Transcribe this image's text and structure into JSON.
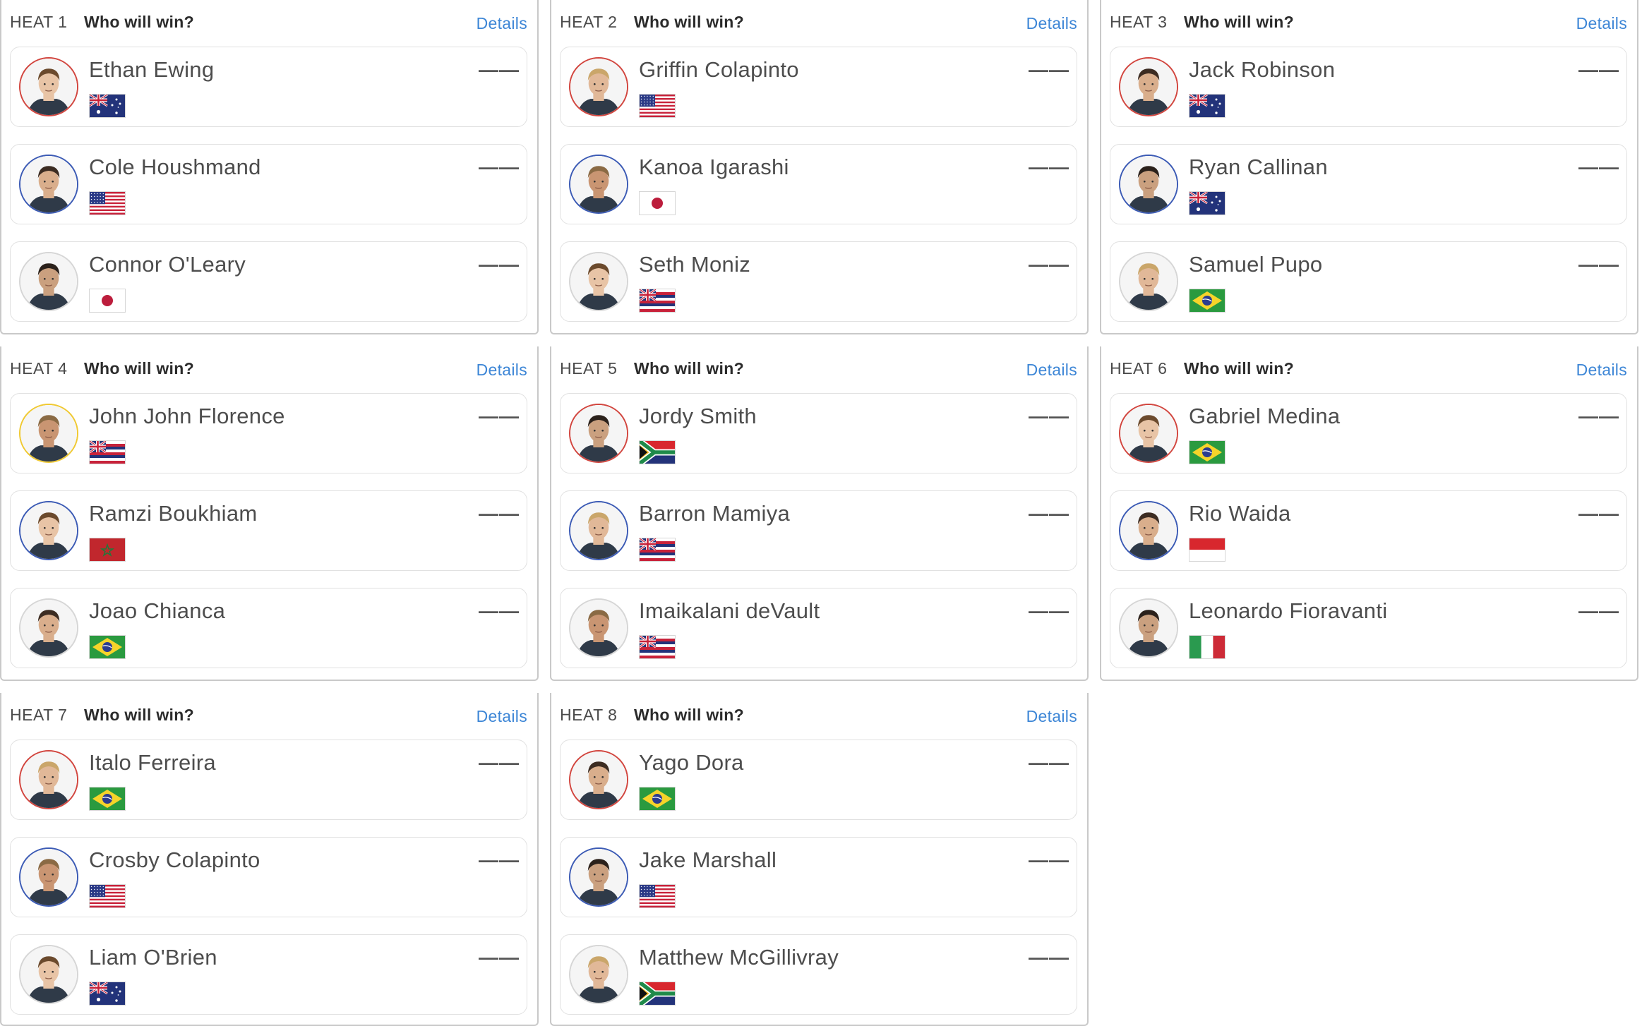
{
  "colors": {
    "ring_red": "#d2463f",
    "ring_blue": "#3c5bb5",
    "ring_yellow": "#f0c932",
    "ring_none": "#d6d6d6",
    "link": "#3d86d6"
  },
  "heats": [
    {
      "label": "HEAT 1",
      "question": "Who will win?",
      "details": "Details",
      "surfers": [
        {
          "name": "Ethan Ewing",
          "score": "——",
          "flag": "australia-flag",
          "ring": "ring_red",
          "avatar": "surfer-portrait-icon"
        },
        {
          "name": "Cole Houshmand",
          "score": "——",
          "flag": "usa-flag",
          "ring": "ring_blue",
          "avatar": "surfer-portrait-icon"
        },
        {
          "name": "Connor O'Leary",
          "score": "——",
          "flag": "japan-flag",
          "ring": "ring_none",
          "avatar": "surfer-portrait-icon"
        }
      ]
    },
    {
      "label": "HEAT 2",
      "question": "Who will win?",
      "details": "Details",
      "surfers": [
        {
          "name": "Griffin Colapinto",
          "score": "——",
          "flag": "usa-flag",
          "ring": "ring_red",
          "avatar": "surfer-portrait-icon"
        },
        {
          "name": "Kanoa Igarashi",
          "score": "——",
          "flag": "japan-flag",
          "ring": "ring_blue",
          "avatar": "surfer-portrait-icon"
        },
        {
          "name": "Seth Moniz",
          "score": "——",
          "flag": "hawaii-flag",
          "ring": "ring_none",
          "avatar": "surfer-portrait-icon"
        }
      ]
    },
    {
      "label": "HEAT 3",
      "question": "Who will win?",
      "details": "Details",
      "surfers": [
        {
          "name": "Jack Robinson",
          "score": "——",
          "flag": "australia-flag",
          "ring": "ring_red",
          "avatar": "surfer-portrait-icon"
        },
        {
          "name": "Ryan Callinan",
          "score": "——",
          "flag": "australia-flag",
          "ring": "ring_blue",
          "avatar": "surfer-portrait-icon"
        },
        {
          "name": "Samuel Pupo",
          "score": "——",
          "flag": "brazil-flag",
          "ring": "ring_none",
          "avatar": "surfer-portrait-icon"
        }
      ]
    },
    {
      "label": "HEAT 4",
      "question": "Who will win?",
      "details": "Details",
      "surfers": [
        {
          "name": "John John Florence",
          "score": "——",
          "flag": "hawaii-flag",
          "ring": "ring_yellow",
          "avatar": "surfer-portrait-icon"
        },
        {
          "name": "Ramzi Boukhiam",
          "score": "——",
          "flag": "morocco-flag",
          "ring": "ring_blue",
          "avatar": "surfer-portrait-icon"
        },
        {
          "name": "Joao Chianca",
          "score": "——",
          "flag": "brazil-flag",
          "ring": "ring_none",
          "avatar": "surfer-portrait-icon"
        }
      ]
    },
    {
      "label": "HEAT 5",
      "question": "Who will win?",
      "details": "Details",
      "surfers": [
        {
          "name": "Jordy Smith",
          "score": "——",
          "flag": "south-africa-flag",
          "ring": "ring_red",
          "avatar": "surfer-portrait-icon"
        },
        {
          "name": "Barron Mamiya",
          "score": "——",
          "flag": "hawaii-flag",
          "ring": "ring_blue",
          "avatar": "surfer-portrait-icon"
        },
        {
          "name": "Imaikalani deVault",
          "score": "——",
          "flag": "hawaii-flag",
          "ring": "ring_none",
          "avatar": "surfer-portrait-icon"
        }
      ]
    },
    {
      "label": "HEAT 6",
      "question": "Who will win?",
      "details": "Details",
      "surfers": [
        {
          "name": "Gabriel Medina",
          "score": "——",
          "flag": "brazil-flag",
          "ring": "ring_red",
          "avatar": "surfer-portrait-icon"
        },
        {
          "name": "Rio Waida",
          "score": "——",
          "flag": "indonesia-flag",
          "ring": "ring_blue",
          "avatar": "surfer-portrait-icon"
        },
        {
          "name": "Leonardo Fioravanti",
          "score": "——",
          "flag": "italy-flag",
          "ring": "ring_none",
          "avatar": "surfer-portrait-icon"
        }
      ]
    },
    {
      "label": "HEAT 7",
      "question": "Who will win?",
      "details": "Details",
      "surfers": [
        {
          "name": "Italo Ferreira",
          "score": "——",
          "flag": "brazil-flag",
          "ring": "ring_red",
          "avatar": "surfer-portrait-icon"
        },
        {
          "name": "Crosby Colapinto",
          "score": "——",
          "flag": "usa-flag",
          "ring": "ring_blue",
          "avatar": "surfer-portrait-icon"
        },
        {
          "name": "Liam O'Brien",
          "score": "——",
          "flag": "australia-flag",
          "ring": "ring_none",
          "avatar": "surfer-portrait-icon"
        }
      ]
    },
    {
      "label": "HEAT 8",
      "question": "Who will win?",
      "details": "Details",
      "surfers": [
        {
          "name": "Yago Dora",
          "score": "——",
          "flag": "brazil-flag",
          "ring": "ring_red",
          "avatar": "surfer-portrait-icon"
        },
        {
          "name": "Jake Marshall",
          "score": "——",
          "flag": "usa-flag",
          "ring": "ring_blue",
          "avatar": "surfer-portrait-icon"
        },
        {
          "name": "Matthew McGillivray",
          "score": "——",
          "flag": "south-africa-flag",
          "ring": "ring_none",
          "avatar": "surfer-portrait-icon"
        }
      ]
    }
  ]
}
